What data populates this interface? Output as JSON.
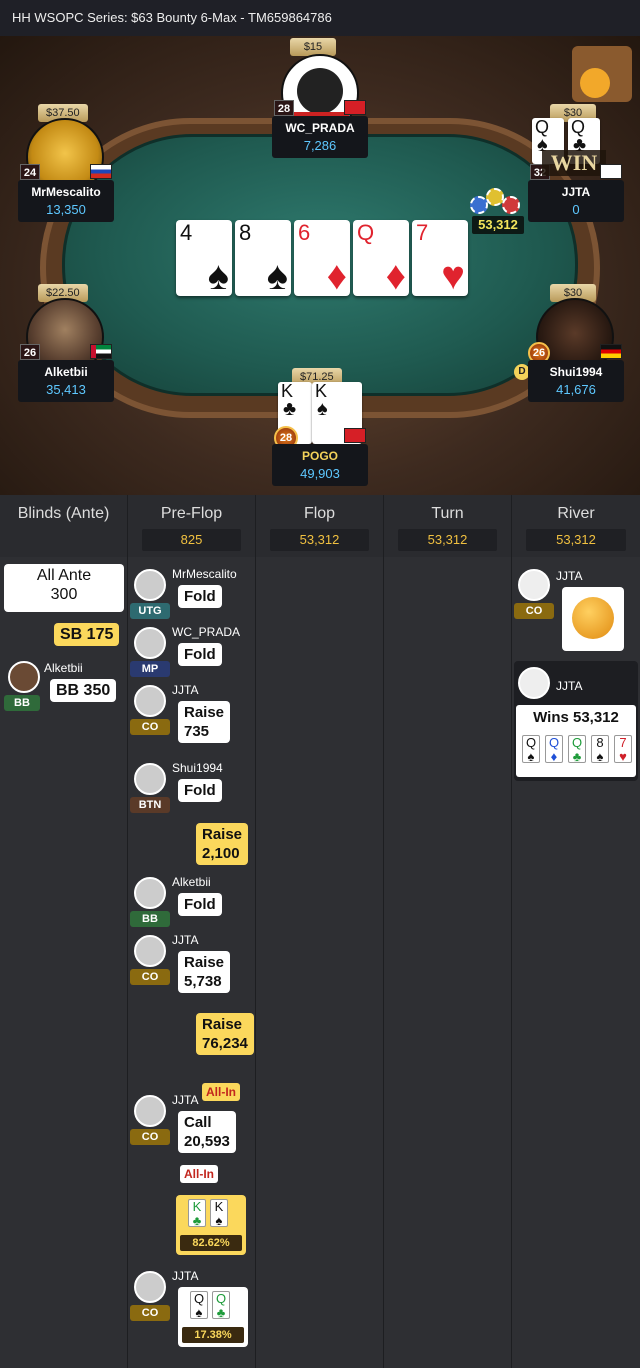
{
  "title": "HH  WSOPC Series: $63 Bounty 6-Max    - TM659864786",
  "table": {
    "board": [
      {
        "rank": "4",
        "suit": "♠",
        "color": "black"
      },
      {
        "rank": "8",
        "suit": "♠",
        "color": "black"
      },
      {
        "rank": "6",
        "suit": "♦",
        "color": "red"
      },
      {
        "rank": "Q",
        "suit": "♦",
        "color": "red"
      },
      {
        "rank": "7",
        "suit": "♥",
        "color": "red"
      }
    ],
    "pot": "53,312",
    "players": [
      {
        "name": "WC_PRADA",
        "stack": "7,286",
        "bounty": "$15",
        "level": "28"
      },
      {
        "name": "MrMescalito",
        "stack": "13,350",
        "bounty": "$37.50",
        "level": "24"
      },
      {
        "name": "JJTA",
        "stack": "0",
        "bounty": "$30",
        "level": "32",
        "win_label": "WIN",
        "hole": [
          "Q♠",
          "Q♣"
        ]
      },
      {
        "name": "Alketbii",
        "stack": "35,413",
        "bounty": "$22.50",
        "level": "26"
      },
      {
        "name": "Shui1994",
        "stack": "41,676",
        "bounty": "$30",
        "level": "26",
        "dealer": "D"
      },
      {
        "name": "POGO",
        "stack": "49,903",
        "bounty": "$71.25",
        "level": "28",
        "hole": [
          "K♣",
          "K♠"
        ]
      }
    ]
  },
  "history": {
    "columns": [
      {
        "title": "Blinds (Ante)",
        "pot": ""
      },
      {
        "title": "Pre-Flop",
        "pot": "825"
      },
      {
        "title": "Flop",
        "pot": "53,312"
      },
      {
        "title": "Turn",
        "pot": "53,312"
      },
      {
        "title": "River",
        "pot": "53,312"
      }
    ],
    "blinds": {
      "ante_l1": "All Ante",
      "ante_l2": "300",
      "sb": "SB  175",
      "bb_name": "Alketbii",
      "bb_pos": "BB",
      "bb": "BB  350"
    },
    "preflop": [
      {
        "name": "MrMescalito",
        "pos": "UTG",
        "action": "Fold"
      },
      {
        "name": "WC_PRADA",
        "pos": "MP",
        "action": "Fold"
      },
      {
        "name": "JJTA",
        "pos": "CO",
        "action": "Raise",
        "amount": "735"
      },
      {
        "name": "Shui1994",
        "pos": "BTN",
        "action": "Fold"
      },
      {
        "name": "",
        "pos": "",
        "action": "Raise",
        "amount": "2,100"
      },
      {
        "name": "Alketbii",
        "pos": "BB",
        "action": "Fold"
      },
      {
        "name": "JJTA",
        "pos": "CO",
        "action": "Raise",
        "amount": "5,738"
      },
      {
        "name": "",
        "pos": "",
        "action": "Raise",
        "amount": "76,234",
        "badge": "All-In"
      },
      {
        "name": "JJTA",
        "pos": "CO",
        "action": "Call",
        "amount": "20,593",
        "badge": "All-In"
      },
      {
        "name": "",
        "pos": "",
        "equity": "82.62%",
        "cards": [
          "K",
          "K"
        ]
      },
      {
        "name": "JJTA",
        "pos": "CO",
        "equity": "17.38%",
        "cards": [
          "Q",
          "Q"
        ]
      }
    ],
    "river": {
      "name1": "JJTA",
      "pos1": "CO",
      "name2": "JJTA",
      "wins": "Wins 53,312",
      "cards": [
        {
          "r": "Q",
          "s": "♠",
          "c": "#111"
        },
        {
          "r": "Q",
          "s": "♦",
          "c": "#1f4fd6"
        },
        {
          "r": "Q",
          "s": "♣",
          "c": "#1e9b3a"
        },
        {
          "r": "8",
          "s": "♠",
          "c": "#111"
        },
        {
          "r": "7",
          "s": "♥",
          "c": "#d0202a"
        }
      ]
    }
  }
}
